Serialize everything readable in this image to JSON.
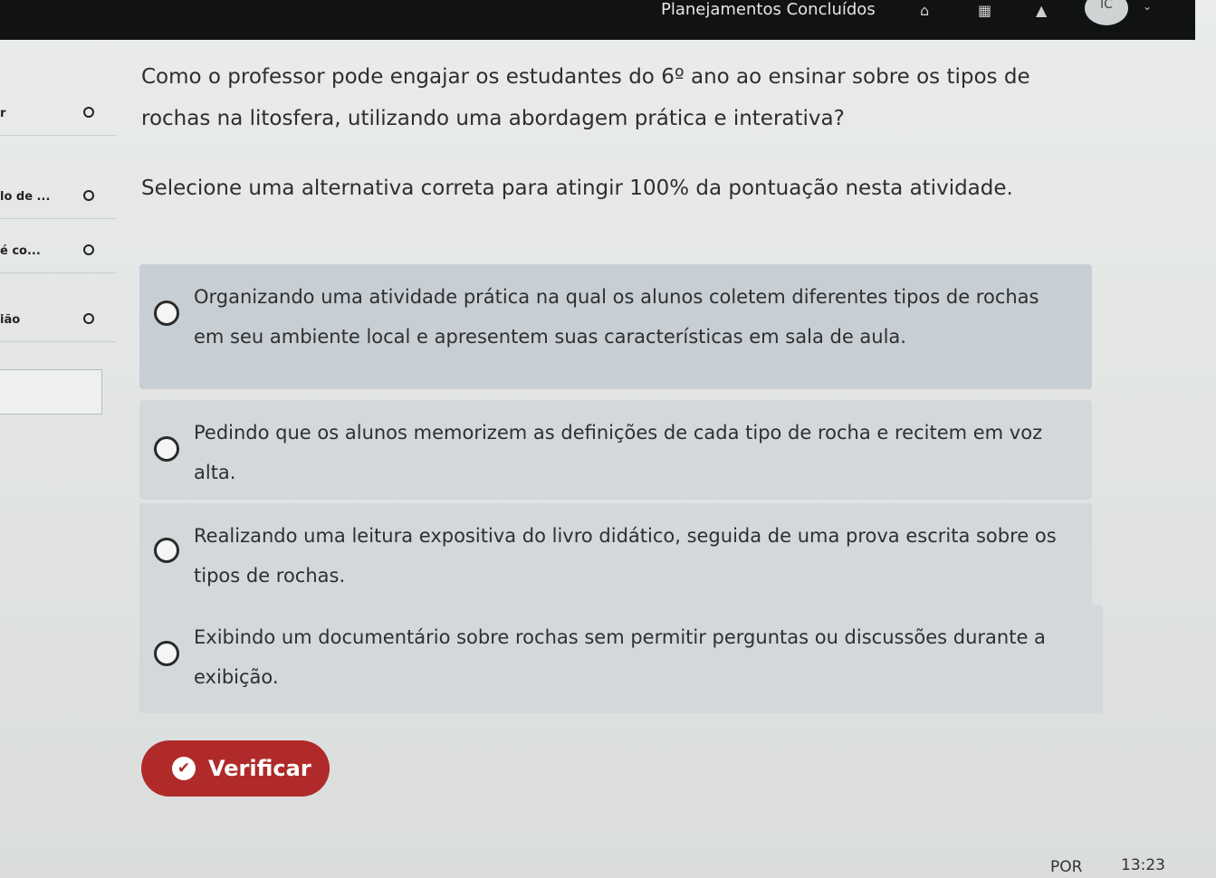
{
  "header": {
    "title": "Planejamentos Concluídos",
    "icons": [
      "home-icon",
      "grid-icon",
      "bell-icon"
    ],
    "avatar_initials": "IC"
  },
  "sidebar": {
    "items": [
      {
        "label": "r"
      },
      {
        "label": "lo de ..."
      },
      {
        "label": "é co..."
      },
      {
        "label": "ião"
      }
    ]
  },
  "question": {
    "text": "Como o professor pode engajar os estudantes do 6º ano ao ensinar sobre os tipos de rochas na litosfera, utilizando uma abordagem prática e interativa?",
    "instruction": "Selecione uma alternativa correta para atingir 100% da pontuação nesta atividade."
  },
  "options": [
    {
      "text": "Organizando uma atividade prática na qual os alunos coletem diferentes tipos de rochas em seu ambiente local e apresentem suas características em sala de aula."
    },
    {
      "text": "Pedindo que os alunos memorizem as definições de cada tipo de rocha e recitem em voz alta."
    },
    {
      "text": "Realizando uma leitura expositiva do livro didático, seguida de uma prova escrita sobre os tipos de rochas."
    },
    {
      "text": "Exibindo um documentário sobre rochas sem permitir perguntas ou discussões durante a exibição."
    }
  ],
  "verify_button": {
    "label": "Verificar"
  },
  "taskbar": {
    "language": "POR",
    "time": "13:23"
  },
  "colors": {
    "accent": "#b02a2a",
    "option_bg": "#d3d8db",
    "topbar": "#101214"
  }
}
